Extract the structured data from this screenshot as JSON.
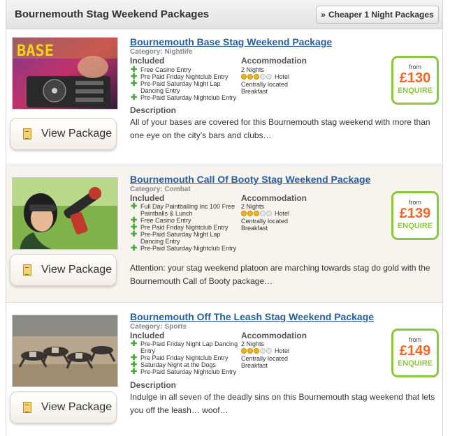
{
  "header": {
    "title": "Bournemouth Stag Weekend Packages",
    "cheaper_arrows": "»",
    "cheaper_label": "Cheaper 1 Night Packages"
  },
  "labels": {
    "included": "Included",
    "accommodation": "Accommodation",
    "description": "Description",
    "view_package": "View Package",
    "from": "from",
    "enquire": "ENQUIRE",
    "hotel": "Hotel"
  },
  "packages": [
    {
      "title": "Bournemouth Base Stag Weekend Package",
      "category": "Category: Nightlife",
      "included": [
        "Free Casino Entry",
        "Pre Paid Friday Nightclub Entry",
        "Pre-Paid Saturday Night Lap Dancing Entry",
        "Pre-Paid Saturday Nightclub Entry"
      ],
      "nights": "2 Nights",
      "stars": 3,
      "location": "Centrally located",
      "board": "Breakfast",
      "description": "All of your bases are covered for this Bournemouth stag weekend with more than one eye on the city’s bars and clubs…",
      "price": "£130",
      "image": "nightclub-dj-photo"
    },
    {
      "title": "Bournemouth Call Of Booty Stag Weekend Package",
      "category": "Category: Combat",
      "included": [
        "Full Day Paintballing Inc 100 Free Paintballs & Lunch",
        "Free Casino Entry",
        "Pre Paid Friday Nightclub Entry",
        "Pre-Paid Saturday Night Lap Dancing Entry",
        "Pre-Paid Saturday Nightclub Entry"
      ],
      "nights": "2 Nights",
      "stars": 3,
      "location": "Centrally located",
      "board": "Breakfast",
      "description": "Attention: your stag weekend platoon are marching towards stag do gold with the Bournemouth Call of Booty package…",
      "price": "£139",
      "image": "paintball-woman-photo"
    },
    {
      "title": "Bournemouth Off The Leash Stag Weekend Package",
      "category": "Category: Sports",
      "included": [
        "Pre-Paid Friday Night Lap Dancing Entry",
        "Pre Paid Friday Nightclub Entry",
        "Saturday Night at the Dogs",
        "Pre-Paid Saturday Nightclub Entry"
      ],
      "nights": "2 Nights",
      "stars": 3,
      "location": "Centrally located",
      "board": "Breakfast",
      "description": "Indulge in all seven of the deadly sins on this Bournemouth stag weekend that lets you off the leash… woof…",
      "price": "£149",
      "image": "greyhound-racing-photo"
    }
  ],
  "colors": {
    "title_link": "#2a5c9a",
    "price": "#f26522",
    "enquire_green": "#8cc63f",
    "plus_green": "#47a83a",
    "alt_row": "#f7f3ee"
  }
}
